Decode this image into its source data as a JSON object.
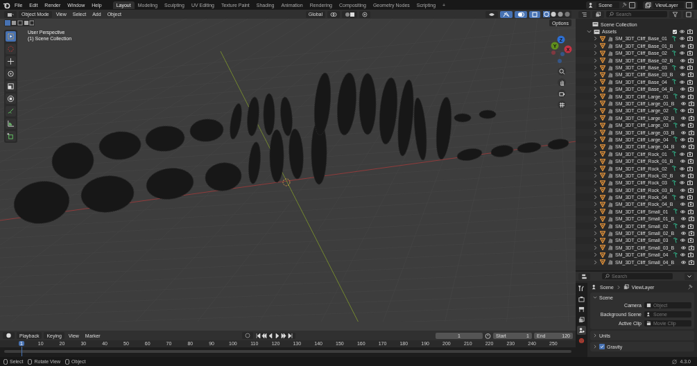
{
  "menu": [
    "File",
    "Edit",
    "Render",
    "Window",
    "Help"
  ],
  "workspaces": [
    {
      "label": "Layout",
      "selected": true
    },
    {
      "label": "Modeling",
      "selected": false
    },
    {
      "label": "Sculpting",
      "selected": false
    },
    {
      "label": "UV Editing",
      "selected": false
    },
    {
      "label": "Texture Paint",
      "selected": false
    },
    {
      "label": "Shading",
      "selected": false
    },
    {
      "label": "Animation",
      "selected": false
    },
    {
      "label": "Rendering",
      "selected": false
    },
    {
      "label": "Compositing",
      "selected": false
    },
    {
      "label": "Geometry Nodes",
      "selected": false
    },
    {
      "label": "Scripting",
      "selected": false
    }
  ],
  "add_workspace": "+",
  "scene_selector": "Scene",
  "view_layer_selector": "ViewLayer",
  "viewport": {
    "mode": "Object Mode",
    "menus": [
      "View",
      "Select",
      "Add",
      "Object"
    ],
    "orientation": "Global",
    "options": "Options",
    "perspective": "User Perspective",
    "collection": "(1) Scene Collection",
    "axes": [
      "Z",
      "Y",
      "X"
    ],
    "tools": [
      {
        "kind": "select",
        "selected": true
      },
      {
        "kind": "cursor",
        "selected": false
      },
      {
        "kind": "move",
        "selected": false
      },
      {
        "kind": "rotate",
        "selected": false
      },
      {
        "kind": "scale",
        "selected": false
      },
      {
        "kind": "transform",
        "selected": false
      },
      {
        "kind": "annotate",
        "selected": false
      },
      {
        "kind": "measure",
        "selected": false
      },
      {
        "kind": "add-cube",
        "selected": false
      }
    ]
  },
  "outliner": {
    "search_placeholder": "Search",
    "root": "Scene Collection",
    "collection": {
      "name": "Assets",
      "checked": true,
      "expanded": true
    },
    "items": [
      {
        "name": "SM_3DT_Cliff_Base_01",
        "has_modifier": true
      },
      {
        "name": "SM_3DT_Cliff_Base_01_B",
        "has_modifier": false
      },
      {
        "name": "SM_3DT_Cliff_Base_02",
        "has_modifier": true
      },
      {
        "name": "SM_3DT_Cliff_Base_02_B",
        "has_modifier": false
      },
      {
        "name": "SM_3DT_Cliff_Base_03",
        "has_modifier": true
      },
      {
        "name": "SM_3DT_Cliff_Base_03_B",
        "has_modifier": false
      },
      {
        "name": "SM_3DT_Cliff_Base_04",
        "has_modifier": true
      },
      {
        "name": "SM_3DT_Cliff_Base_04_B",
        "has_modifier": false
      },
      {
        "name": "SM_3DT_Cliff_Large_01",
        "has_modifier": true
      },
      {
        "name": "SM_3DT_Cliff_Large_01_B",
        "has_modifier": false
      },
      {
        "name": "SM_3DT_Cliff_Large_02",
        "has_modifier": true
      },
      {
        "name": "SM_3DT_Cliff_Large_02_B",
        "has_modifier": false
      },
      {
        "name": "SM_3DT_Cliff_Large_03",
        "has_modifier": true
      },
      {
        "name": "SM_3DT_Cliff_Large_03_B",
        "has_modifier": false
      },
      {
        "name": "SM_3DT_Cliff_Large_04",
        "has_modifier": true
      },
      {
        "name": "SM_3DT_Cliff_Large_04_B",
        "has_modifier": false
      },
      {
        "name": "SM_3DT_Cliff_Rock_01",
        "has_modifier": true
      },
      {
        "name": "SM_3DT_Cliff_Rock_01_B",
        "has_modifier": false
      },
      {
        "name": "SM_3DT_Cliff_Rock_02",
        "has_modifier": true
      },
      {
        "name": "SM_3DT_Cliff_Rock_02_B",
        "has_modifier": false
      },
      {
        "name": "SM_3DT_Cliff_Rock_03",
        "has_modifier": true
      },
      {
        "name": "SM_3DT_Cliff_Rock_03_B",
        "has_modifier": false
      },
      {
        "name": "SM_3DT_Cliff_Rock_04",
        "has_modifier": true
      },
      {
        "name": "SM_3DT_Cliff_Rock_04_B",
        "has_modifier": false
      },
      {
        "name": "SM_3DT_Cliff_Small_01",
        "has_modifier": true
      },
      {
        "name": "SM_3DT_Cliff_Small_01_B",
        "has_modifier": false
      },
      {
        "name": "SM_3DT_Cliff_Small_02",
        "has_modifier": true
      },
      {
        "name": "SM_3DT_Cliff_Small_02_B",
        "has_modifier": false
      },
      {
        "name": "SM_3DT_Cliff_Small_03",
        "has_modifier": true
      },
      {
        "name": "SM_3DT_Cliff_Small_03_B",
        "has_modifier": false
      },
      {
        "name": "SM_3DT_Cliff_Small_04",
        "has_modifier": true
      },
      {
        "name": "SM_3DT_Cliff_Small_04_B",
        "has_modifier": false
      }
    ]
  },
  "properties": {
    "search_placeholder": "Search",
    "breadcrumb": [
      "Scene",
      "ViewLayer"
    ],
    "tabs": [
      {
        "kind": "tool",
        "selected": false
      },
      {
        "kind": "render",
        "selected": false
      },
      {
        "kind": "output",
        "selected": false
      },
      {
        "kind": "view-layer",
        "selected": false
      },
      {
        "kind": "scene",
        "selected": true
      },
      {
        "kind": "world",
        "selected": false
      }
    ],
    "panel": {
      "title": "Scene",
      "expanded": true,
      "fields": [
        {
          "label": "Camera",
          "placeholder": "Object"
        },
        {
          "label": "Background Scene",
          "placeholder": "Scene"
        },
        {
          "label": "Active Clip",
          "placeholder": "Movie Clip"
        }
      ]
    },
    "subpanels": [
      {
        "title": "Units",
        "kind": "plain"
      },
      {
        "title": "Gravity",
        "kind": "checkbox",
        "checked": true
      }
    ]
  },
  "timeline": {
    "menus": [
      "Playback",
      "Keying",
      "View",
      "Marker"
    ],
    "current_frame": "1",
    "start_label": "Start",
    "start": "1",
    "end_label": "End",
    "end": "120",
    "ticks": [
      "1",
      "10",
      "20",
      "30",
      "40",
      "50",
      "60",
      "70",
      "80",
      "90",
      "100",
      "110",
      "120",
      "130",
      "140",
      "150",
      "160",
      "170",
      "180",
      "190",
      "200",
      "210",
      "220",
      "230",
      "240",
      "250"
    ]
  },
  "status_bar": {
    "hints": [
      "Select",
      "Rotate View",
      "Object"
    ],
    "version": "4.3.0"
  }
}
